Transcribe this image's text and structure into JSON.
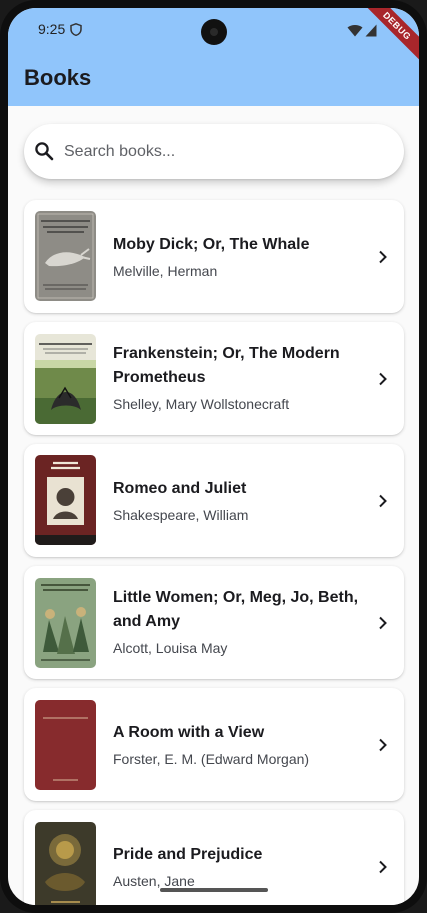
{
  "status_bar": {
    "time": "9:25",
    "debug_label": "DEBUG"
  },
  "app_bar": {
    "title": "Books",
    "color": "#90c5fb"
  },
  "search": {
    "placeholder": "Search books...",
    "value": ""
  },
  "books": [
    {
      "title": "Moby Dick; Or, The Whale",
      "author": "Melville, Herman",
      "cover_icon": "moby-dick-cover"
    },
    {
      "title": "Frankenstein; Or, The Modern Prometheus",
      "author": "Shelley, Mary Wollstonecraft",
      "cover_icon": "frankenstein-cover"
    },
    {
      "title": "Romeo and Juliet",
      "author": "Shakespeare, William",
      "cover_icon": "romeo-and-juliet-cover"
    },
    {
      "title": "Little Women; Or, Meg, Jo, Beth, and Amy",
      "author": "Alcott, Louisa May",
      "cover_icon": "little-women-cover"
    },
    {
      "title": "A Room with a View",
      "author": "Forster, E. M. (Edward Morgan)",
      "cover_icon": "room-with-a-view-cover"
    },
    {
      "title": "Pride and Prejudice",
      "author": "Austen, Jane",
      "cover_icon": "pride-and-prejudice-cover"
    }
  ]
}
